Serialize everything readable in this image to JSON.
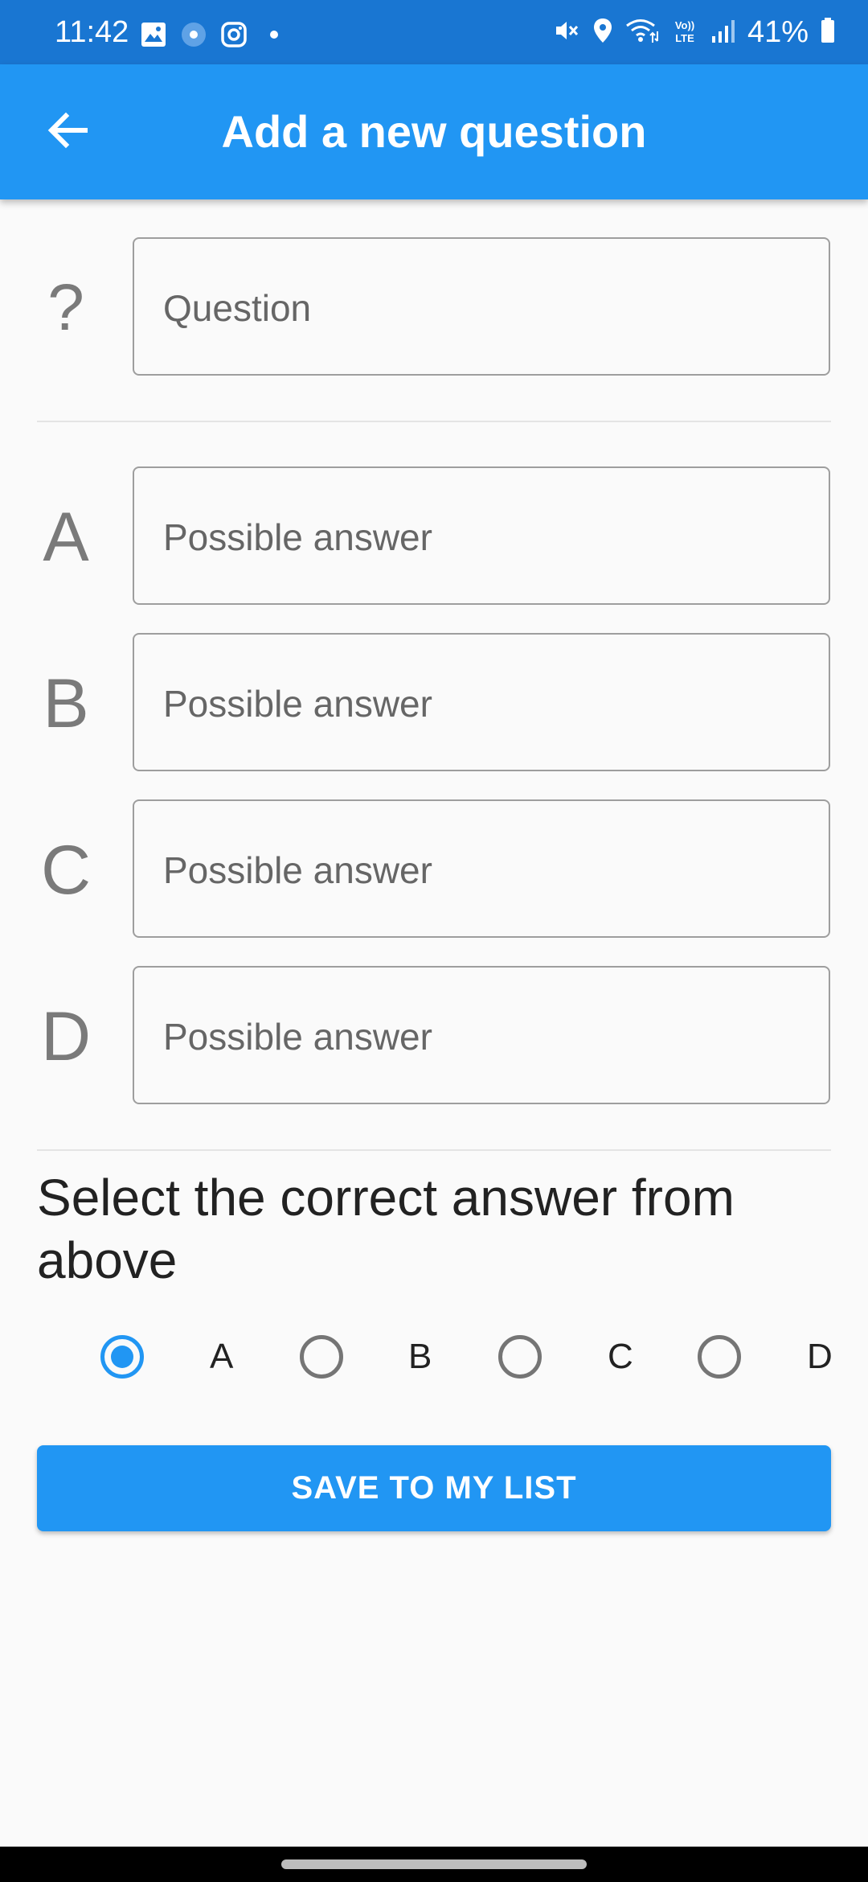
{
  "status_bar": {
    "time": "11:42",
    "battery": "41%",
    "left_icons": [
      "gallery-icon",
      "record-icon",
      "instagram-icon",
      "dot-icon"
    ],
    "right_icons": [
      "mute-icon",
      "location-icon",
      "wifi-icon",
      "volte-icon",
      "signal-icon",
      "battery-icon"
    ]
  },
  "app_bar": {
    "title": "Add a new question",
    "back_icon": "arrow-left-icon"
  },
  "question": {
    "label": "?",
    "placeholder": "Question",
    "value": ""
  },
  "answers": [
    {
      "label": "A",
      "placeholder": "Possible answer",
      "value": ""
    },
    {
      "label": "B",
      "placeholder": "Possible answer",
      "value": ""
    },
    {
      "label": "C",
      "placeholder": "Possible answer",
      "value": ""
    },
    {
      "label": "D",
      "placeholder": "Possible answer",
      "value": ""
    }
  ],
  "correct_answer": {
    "title": "Select the correct answer from above",
    "options": [
      "A",
      "B",
      "C",
      "D"
    ],
    "selected": "A"
  },
  "save_button": "SAVE TO MY LIST",
  "colors": {
    "status_bar": "#1976d2",
    "app_bar": "#2196f3",
    "accent": "#2196f3",
    "background": "#fafafa"
  }
}
